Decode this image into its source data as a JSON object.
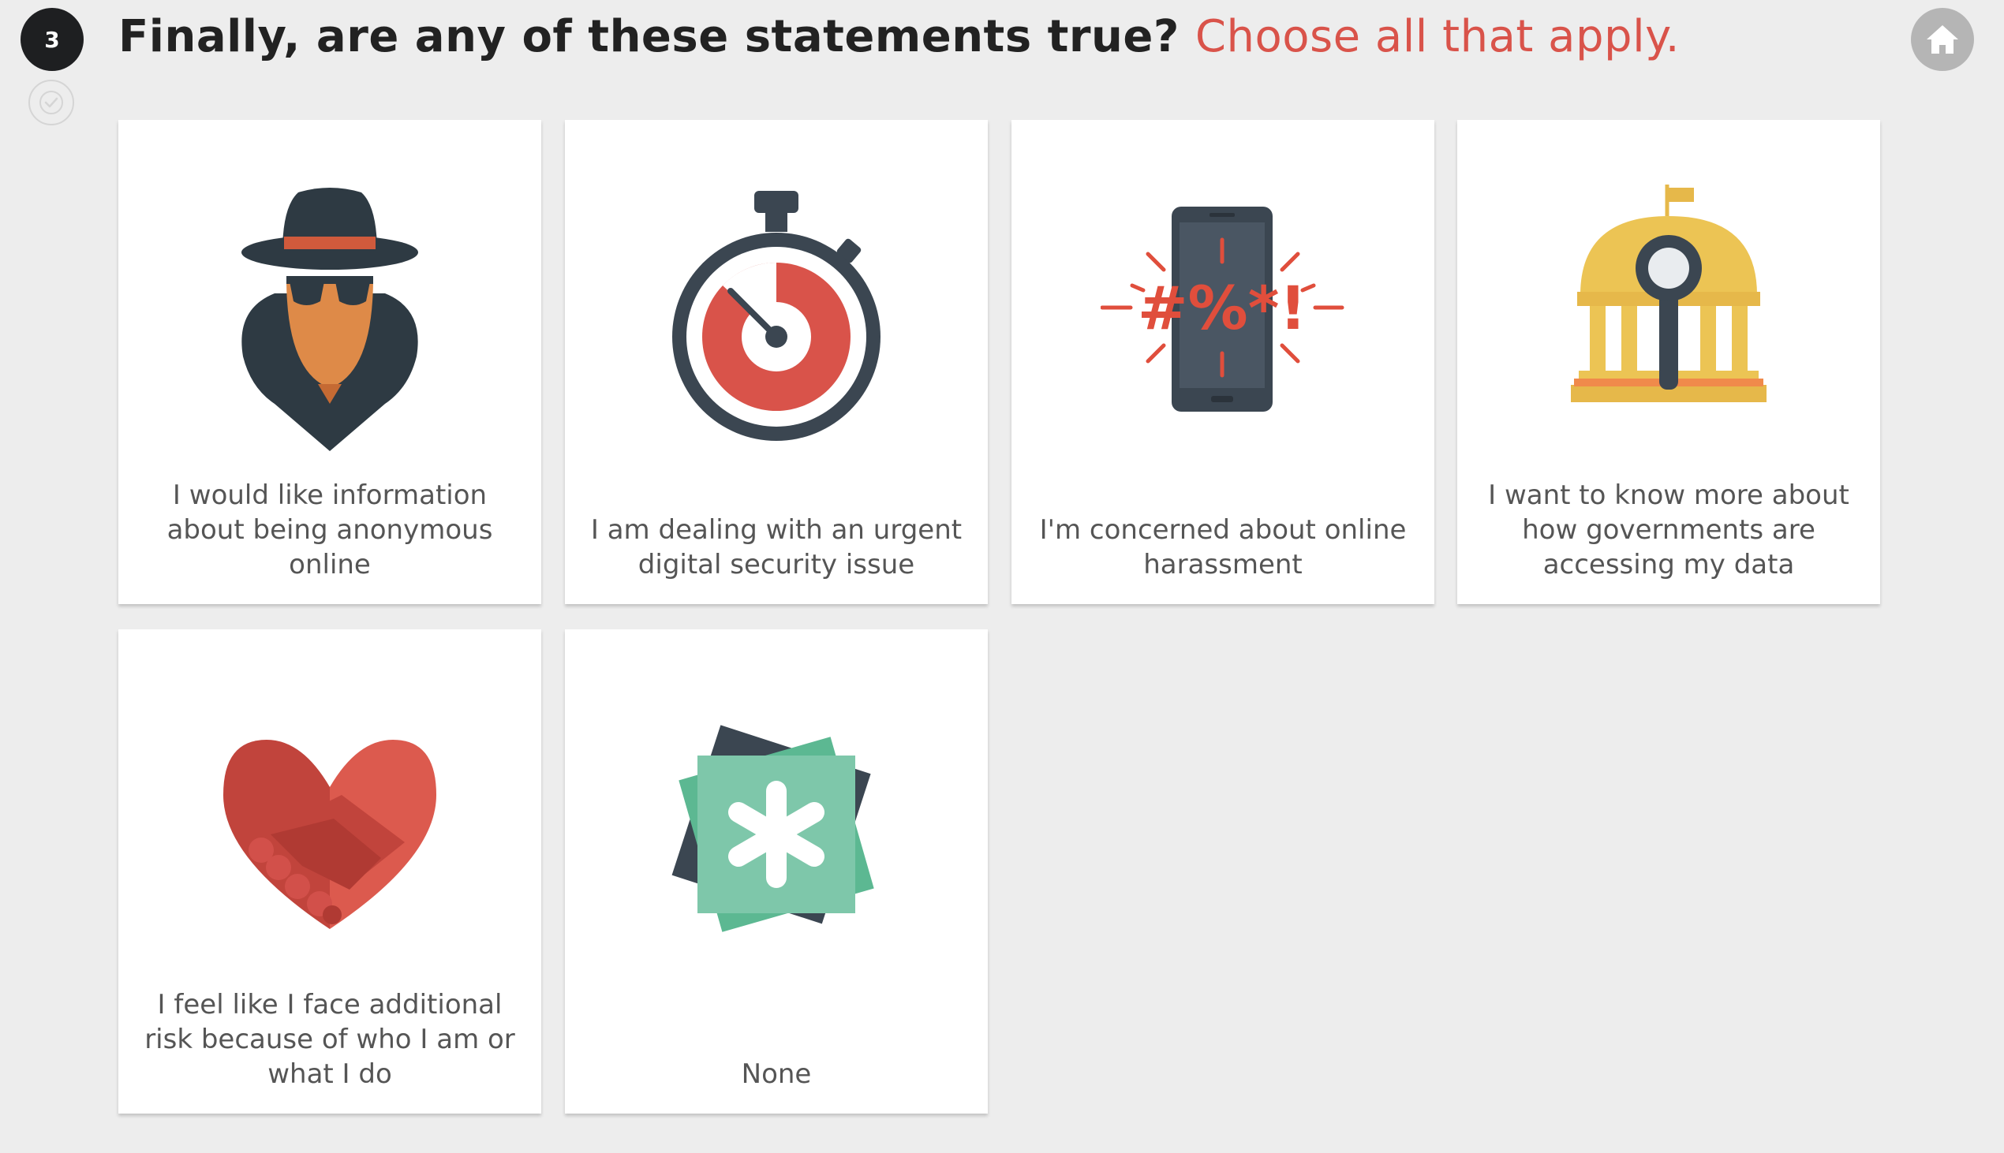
{
  "step": {
    "number": "3"
  },
  "heading": {
    "question": "Finally, are any of these statements true?",
    "hint": "Choose all that apply."
  },
  "colors": {
    "accent": "#d9534a",
    "badge": "#1e1f21",
    "background": "#ededed",
    "card": "#ffffff",
    "label_text": "#555555",
    "home_button": "#b5b5b5"
  },
  "options": [
    {
      "label": "I would like information about being anonymous online",
      "icon": "spy-icon"
    },
    {
      "label": "I am dealing with an urgent digital security issue",
      "icon": "stopwatch-icon"
    },
    {
      "label": "I'm concerned about online harassment",
      "icon": "harassment-phone-icon"
    },
    {
      "label": "I want to know more about how governments are accessing my data",
      "icon": "government-magnifier-icon"
    },
    {
      "label": "I feel like I face additional risk because of who I am or what I do",
      "icon": "handshake-heart-icon"
    },
    {
      "label": "None",
      "icon": "asterisk-cards-icon"
    }
  ]
}
